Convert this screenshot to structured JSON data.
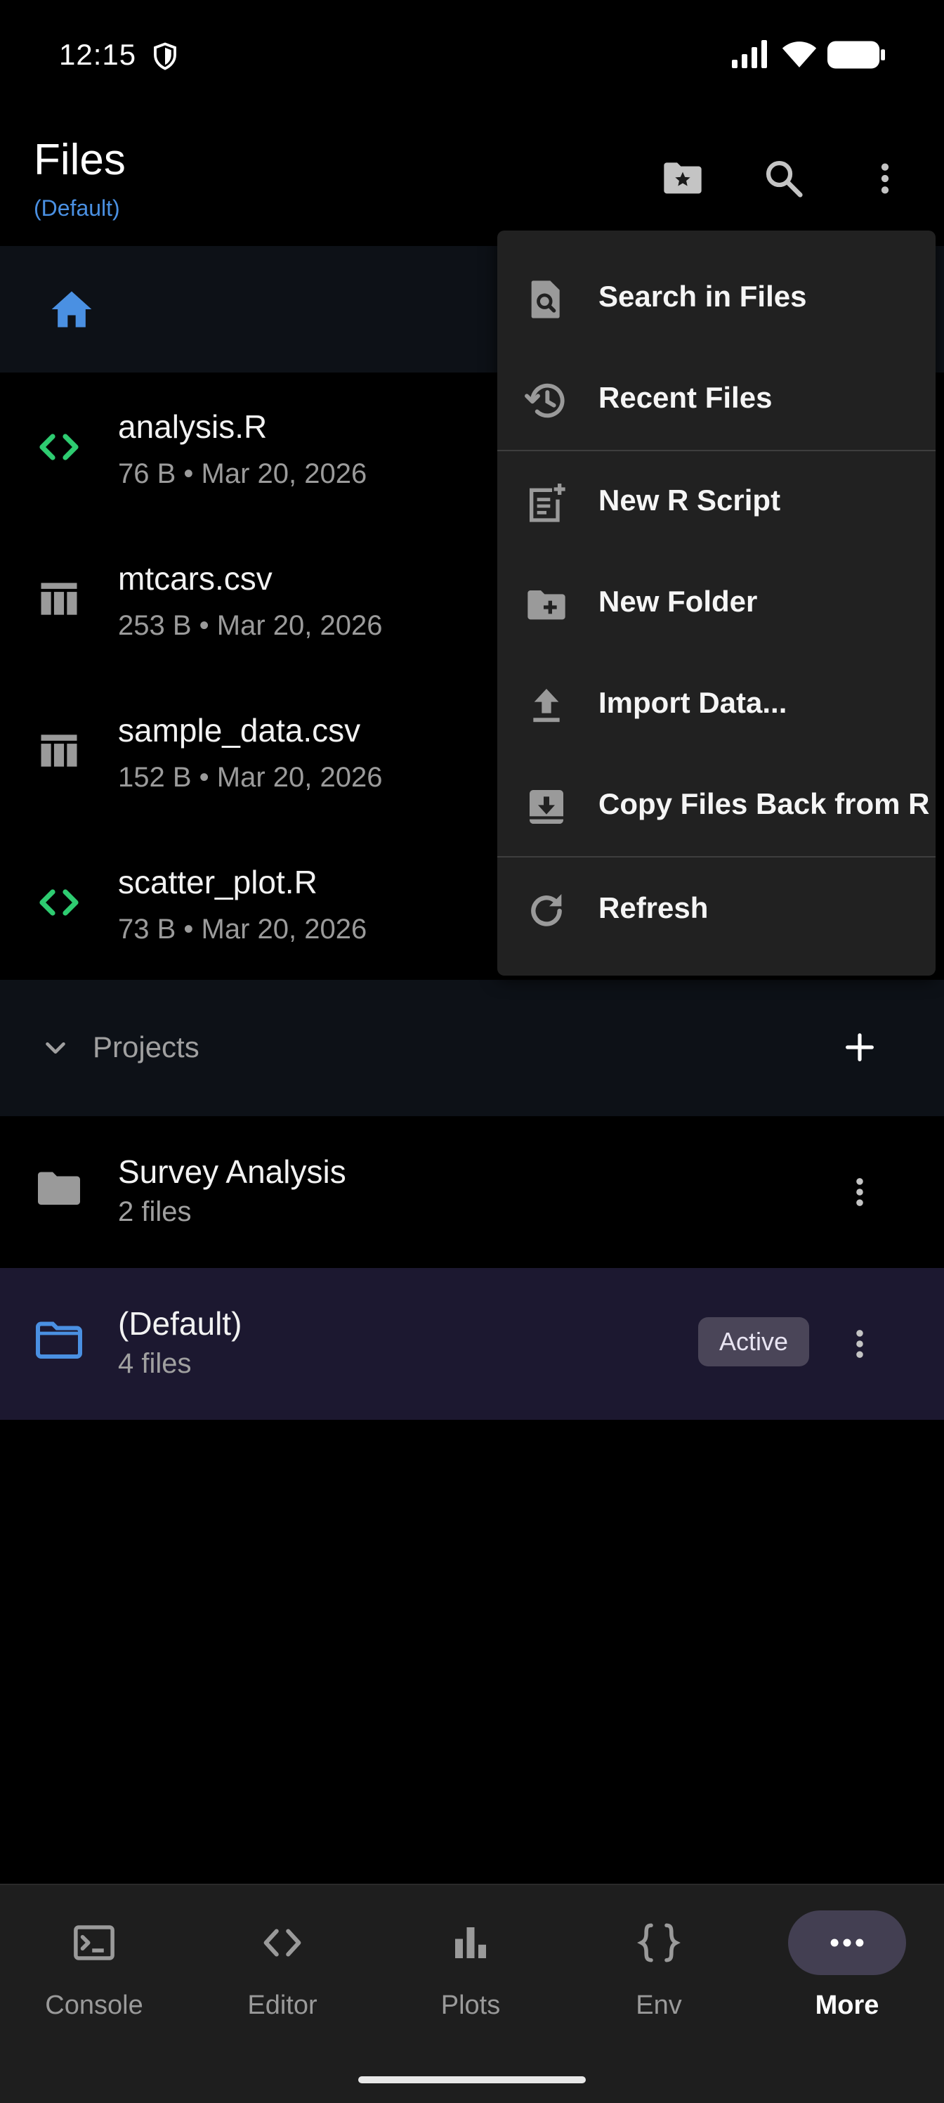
{
  "status_bar": {
    "time": "12:15"
  },
  "header": {
    "title": "Files",
    "subtitle": "(Default)"
  },
  "files": [
    {
      "name": "analysis.R",
      "meta": "76 B • Mar 20, 2026",
      "icon": "code-icon"
    },
    {
      "name": "mtcars.csv",
      "meta": "253 B • Mar 20, 2026",
      "icon": "table-icon"
    },
    {
      "name": "sample_data.csv",
      "meta": "152 B • Mar 20, 2026",
      "icon": "table-icon"
    },
    {
      "name": "scatter_plot.R",
      "meta": "73 B • Mar 20, 2026",
      "icon": "code-icon"
    }
  ],
  "projects": {
    "label": "Projects",
    "items": [
      {
        "name": "Survey Analysis",
        "count": "2 files"
      },
      {
        "name": "(Default)",
        "count": "4 files",
        "badge": "Active"
      }
    ]
  },
  "menu": {
    "items": [
      {
        "label": "Search in Files",
        "icon": "search-file-icon"
      },
      {
        "label": "Recent Files",
        "icon": "history-icon"
      },
      {
        "label": "New R Script",
        "icon": "new-script-icon"
      },
      {
        "label": "New Folder",
        "icon": "new-folder-icon"
      },
      {
        "label": "Import Data...",
        "icon": "upload-icon"
      },
      {
        "label": "Copy Files Back from R",
        "icon": "download-box-icon"
      },
      {
        "label": "Refresh",
        "icon": "refresh-icon"
      }
    ]
  },
  "bottom_nav": {
    "items": [
      {
        "label": "Console",
        "icon": "console-icon"
      },
      {
        "label": "Editor",
        "icon": "code-icon"
      },
      {
        "label": "Plots",
        "icon": "bar-chart-icon"
      },
      {
        "label": "Env",
        "icon": "braces-icon"
      },
      {
        "label": "More",
        "icon": "more-horiz-icon",
        "selected": true
      }
    ]
  },
  "colors": {
    "accent_blue": "#4a90e2",
    "code_green": "#2ecc71",
    "active_row": "#1c1830",
    "badge_bg": "#4a4558",
    "menu_bg": "#212121"
  }
}
